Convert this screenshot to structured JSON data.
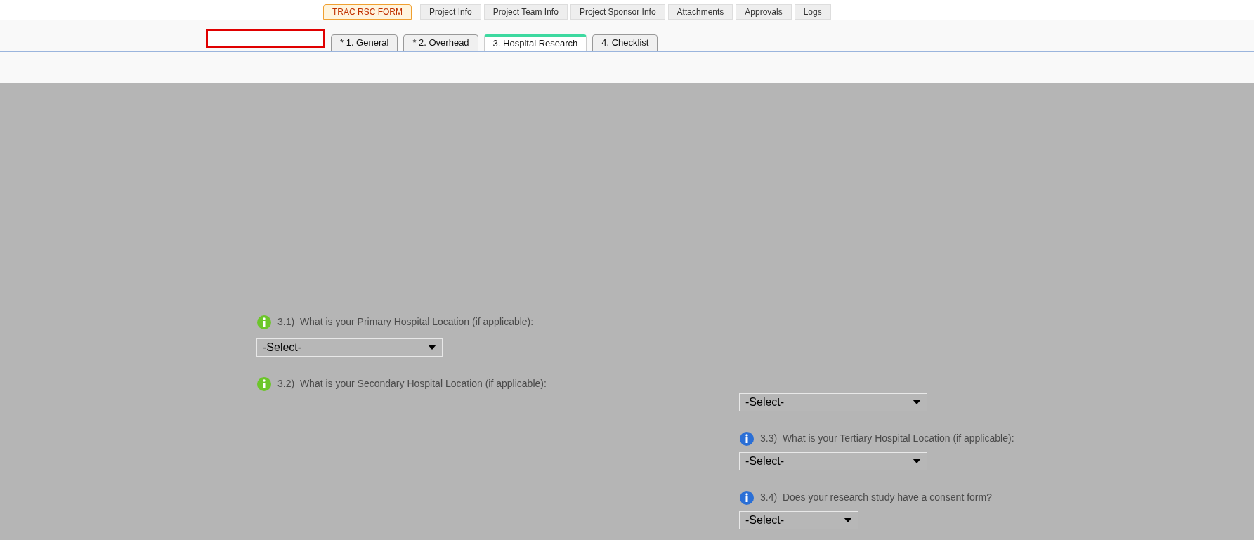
{
  "top_tabs": [
    {
      "label": "TRAC RSC FORM",
      "selected": true
    }
  ],
  "section_tabs": [
    {
      "label": "Project Info",
      "selected": false
    },
    {
      "label": "Project Team Info",
      "selected": false
    },
    {
      "label": "Project Sponsor Info",
      "selected": false
    },
    {
      "label": "Attachments",
      "selected": false
    },
    {
      "label": "Approvals",
      "selected": false
    },
    {
      "label": "Logs",
      "selected": false
    }
  ],
  "step_tabs": [
    {
      "label": "* 1. General",
      "selected": false
    },
    {
      "label": "* 2. Overhead",
      "selected": false
    },
    {
      "label": "3. Hospital Research",
      "selected": true
    },
    {
      "label": "4. Checklist",
      "selected": false
    }
  ],
  "questions": [
    {
      "number": "3.1)",
      "text": "What is your Primary Hospital Location (if applicable):",
      "color": "#6cc62a",
      "value": "-Select-"
    },
    {
      "number": "3.2)",
      "text": "What is your Secondary Hospital Location (if applicable):",
      "color": "#6cc62a",
      "value": "-Select-"
    },
    {
      "number": "3.3)",
      "text": "What is your Tertiary Hospital Location (if applicable):",
      "color": "#2a6fd6",
      "value": "-Select-"
    },
    {
      "number": "3.4)",
      "text": "Does your research study have a consent form?",
      "color": "#2a6fd6",
      "value": "-Select-"
    }
  ]
}
